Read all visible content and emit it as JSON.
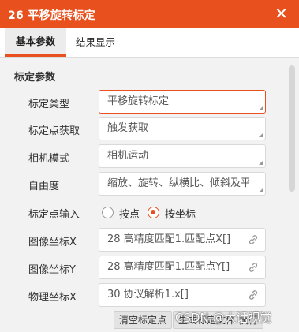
{
  "window": {
    "title": "26 平移旋转标定",
    "close_symbol": "✕"
  },
  "tabs": [
    {
      "label": "基本参数",
      "active": true
    },
    {
      "label": "结果显示",
      "active": false
    }
  ],
  "section": {
    "title": "标定参数"
  },
  "rows": [
    {
      "label": "标定类型",
      "value": "平移旋转标定"
    },
    {
      "label": "标定点获取",
      "value": "触发获取"
    },
    {
      "label": "相机模式",
      "value": "相机运动"
    },
    {
      "label": "自由度",
      "value": "缩放、旋转、纵横比、倾斜及平移"
    },
    {
      "label": "标定点输入"
    },
    {
      "label": "图像坐标X",
      "value": "28 高精度匹配1.匹配点X[]"
    },
    {
      "label": "图像坐标Y",
      "value": "28 高精度匹配1.匹配点Y[]"
    },
    {
      "label": "物理坐标X",
      "value": "30 协议解析1.x[]"
    }
  ],
  "radio": {
    "options": [
      {
        "label": "按点",
        "checked": false
      },
      {
        "label": "按坐标",
        "checked": true
      }
    ]
  },
  "footer": {
    "buttons": [
      {
        "label": "清空标定点"
      },
      {
        "label": "生成标定文件"
      },
      {
        "label": "执行"
      }
    ]
  },
  "watermark": {
    "text": "CSDN @大话视觉"
  },
  "colors": {
    "accent": "#e8501d",
    "panel_bg": "#f2f2f2",
    "title_text": "#ffffff"
  },
  "icons": {
    "close": "close-icon",
    "link": "link-icon",
    "resize": "resize-grip-icon"
  }
}
